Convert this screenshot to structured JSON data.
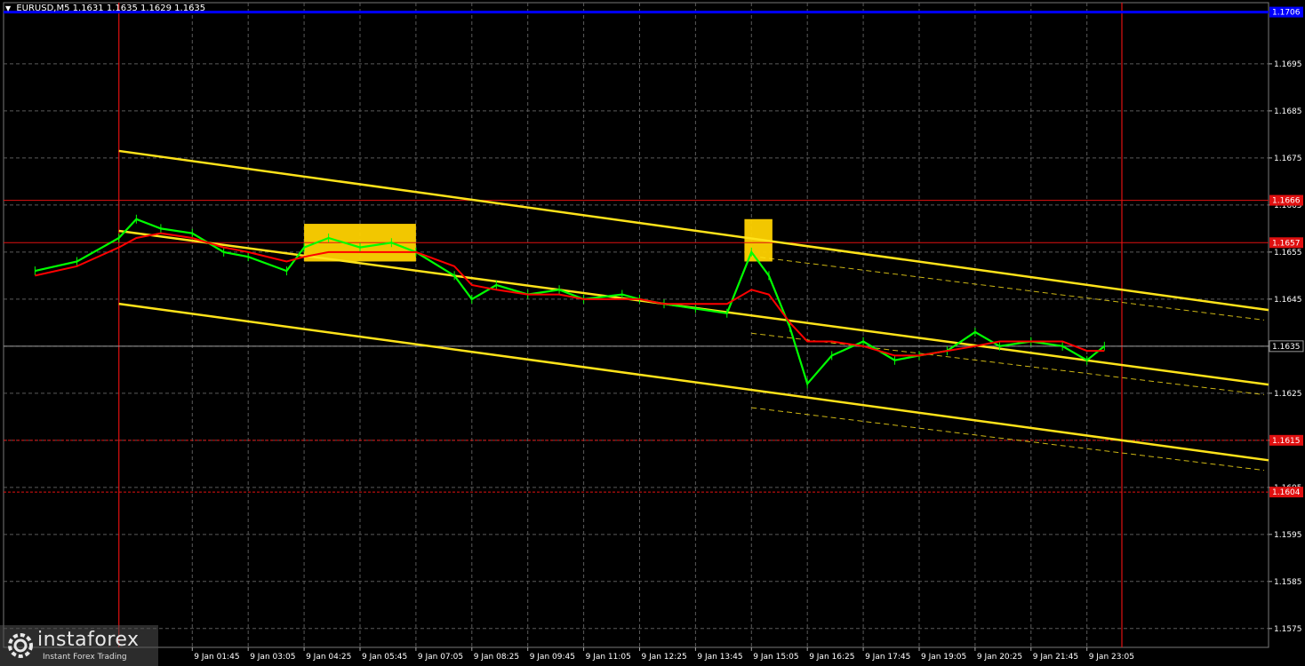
{
  "header": {
    "symbol": "EURUSD,M5",
    "quote": "1.1631 1.1635 1.1629 1.1635"
  },
  "logo": {
    "brand": "instaforex",
    "tagline": "Instant Forex Trading"
  },
  "colors": {
    "background": "#000000",
    "grid": "#5a5a5a",
    "candles": "#00ff00",
    "ma": "#ff0000",
    "channel": "#ffe31a",
    "levels": "#e01010",
    "high_line": "#0000ff",
    "highlight": "#ffd200",
    "axis_text": "#ffffff"
  },
  "chart_data": {
    "type": "line",
    "symbol": "EURUSD",
    "timeframe": "M5",
    "x_axis": {
      "ticks": [
        "9 Jan 01:45",
        "9 Jan 03:05",
        "9 Jan 04:25",
        "9 Jan 05:45",
        "9 Jan 07:05",
        "9 Jan 08:25",
        "9 Jan 09:45",
        "9 Jan 11:05",
        "9 Jan 12:25",
        "9 Jan 13:45",
        "9 Jan 15:05",
        "9 Jan 16:25",
        "9 Jan 17:45",
        "9 Jan 19:05",
        "9 Jan 20:25",
        "9 Jan 21:45",
        "9 Jan 23:05"
      ]
    },
    "y_axis": {
      "ticks": [
        "1.1695",
        "1.1685",
        "1.1675",
        "1.1665",
        "1.1655",
        "1.1645",
        "1.1635",
        "1.1625",
        "1.1615",
        "1.1605",
        "1.1595",
        "1.1585",
        "1.1575"
      ],
      "range": [
        1.1571,
        1.1708
      ],
      "grid": true
    },
    "levels": [
      {
        "label": "1.1706",
        "price": 1.1706,
        "style": "solid",
        "color": "blue"
      },
      {
        "label": "1.1666",
        "price": 1.1666,
        "style": "solid",
        "color": "red"
      },
      {
        "label": "1.1657",
        "price": 1.1657,
        "style": "solid",
        "color": "red"
      },
      {
        "label": "1.1615",
        "price": 1.1615,
        "style": "dashed",
        "color": "red"
      },
      {
        "label": "1.1604",
        "price": 1.1604,
        "style": "dashed",
        "color": "red"
      },
      {
        "label": "1.1635",
        "price": 1.1635,
        "style": "current",
        "color": "gray"
      }
    ],
    "vertical_markers": [
      "9 Jan 00:00",
      "9 Jan 23:55"
    ],
    "highlight_zones": [
      {
        "from": "9 Jan 04:25",
        "to": "9 Jan 07:05",
        "high": 1.1661,
        "low": 1.1653
      },
      {
        "from": "9 Jan 14:55",
        "to": "9 Jan 15:35",
        "high": 1.1662,
        "low": 1.1653
      }
    ],
    "trend_channel": [
      {
        "start": [
          "9 Jan 00:00",
          1.16765
        ],
        "end": [
          "9 Jan 23:55",
          1.1647
        ]
      },
      {
        "start": [
          "9 Jan 00:00",
          1.16595
        ],
        "end": [
          "9 Jan 23:55",
          1.1631
        ]
      },
      {
        "start": [
          "9 Jan 00:00",
          1.1644
        ],
        "end": [
          "9 Jan 23:55",
          1.1615
        ]
      }
    ],
    "series": [
      {
        "kind": "candles",
        "x": [
          "8 Jan 22:00",
          "8 Jan 23:00",
          "9 Jan 00:00",
          "9 Jan 00:25",
          "9 Jan 01:00",
          "9 Jan 01:45",
          "9 Jan 02:30",
          "9 Jan 03:05",
          "9 Jan 04:00",
          "9 Jan 04:25",
          "9 Jan 05:00",
          "9 Jan 05:45",
          "9 Jan 06:30",
          "9 Jan 07:05",
          "9 Jan 08:00",
          "9 Jan 08:25",
          "9 Jan 09:00",
          "9 Jan 09:45",
          "9 Jan 10:30",
          "9 Jan 11:05",
          "9 Jan 12:00",
          "9 Jan 12:25",
          "9 Jan 13:00",
          "9 Jan 13:45",
          "9 Jan 14:30",
          "9 Jan 15:05",
          "9 Jan 15:30",
          "9 Jan 16:00",
          "9 Jan 16:25",
          "9 Jan 17:00",
          "9 Jan 17:45",
          "9 Jan 18:30",
          "9 Jan 19:05",
          "9 Jan 19:45",
          "9 Jan 20:25",
          "9 Jan 21:00",
          "9 Jan 21:45",
          "9 Jan 22:30",
          "9 Jan 23:05",
          "9 Jan 23:30"
        ],
        "values": [
          1.1651,
          1.1653,
          1.1658,
          1.1662,
          1.166,
          1.1659,
          1.1655,
          1.1654,
          1.1651,
          1.1656,
          1.1658,
          1.1656,
          1.1657,
          1.1655,
          1.165,
          1.1645,
          1.1648,
          1.1646,
          1.1647,
          1.1645,
          1.1646,
          1.1645,
          1.1644,
          1.1643,
          1.1642,
          1.1655,
          1.165,
          1.1639,
          1.1627,
          1.1633,
          1.1636,
          1.1632,
          1.1633,
          1.1634,
          1.1638,
          1.1635,
          1.1636,
          1.1635,
          1.1632,
          1.1635
        ]
      },
      {
        "kind": "moving-average",
        "x": [
          "8 Jan 22:00",
          "8 Jan 23:00",
          "9 Jan 00:00",
          "9 Jan 00:25",
          "9 Jan 01:00",
          "9 Jan 01:45",
          "9 Jan 02:30",
          "9 Jan 03:05",
          "9 Jan 04:00",
          "9 Jan 04:25",
          "9 Jan 05:00",
          "9 Jan 05:45",
          "9 Jan 06:30",
          "9 Jan 07:05",
          "9 Jan 08:00",
          "9 Jan 08:25",
          "9 Jan 09:00",
          "9 Jan 09:45",
          "9 Jan 10:30",
          "9 Jan 11:05",
          "9 Jan 12:00",
          "9 Jan 12:25",
          "9 Jan 13:00",
          "9 Jan 13:45",
          "9 Jan 14:30",
          "9 Jan 15:05",
          "9 Jan 15:30",
          "9 Jan 16:00",
          "9 Jan 16:25",
          "9 Jan 17:00",
          "9 Jan 17:45",
          "9 Jan 18:30",
          "9 Jan 19:05",
          "9 Jan 19:45",
          "9 Jan 20:25",
          "9 Jan 21:00",
          "9 Jan 21:45",
          "9 Jan 22:30",
          "9 Jan 23:05",
          "9 Jan 23:30"
        ],
        "values": [
          1.165,
          1.1652,
          1.1656,
          1.1658,
          1.1659,
          1.1658,
          1.1656,
          1.1655,
          1.1653,
          1.1654,
          1.1655,
          1.1655,
          1.1655,
          1.1655,
          1.1652,
          1.1648,
          1.1647,
          1.1646,
          1.1646,
          1.1645,
          1.1645,
          1.1645,
          1.1644,
          1.1644,
          1.1644,
          1.1647,
          1.1646,
          1.164,
          1.1636,
          1.1636,
          1.1635,
          1.1633,
          1.1633,
          1.1634,
          1.1635,
          1.1636,
          1.1636,
          1.1636,
          1.1634,
          1.1634
        ]
      }
    ]
  }
}
